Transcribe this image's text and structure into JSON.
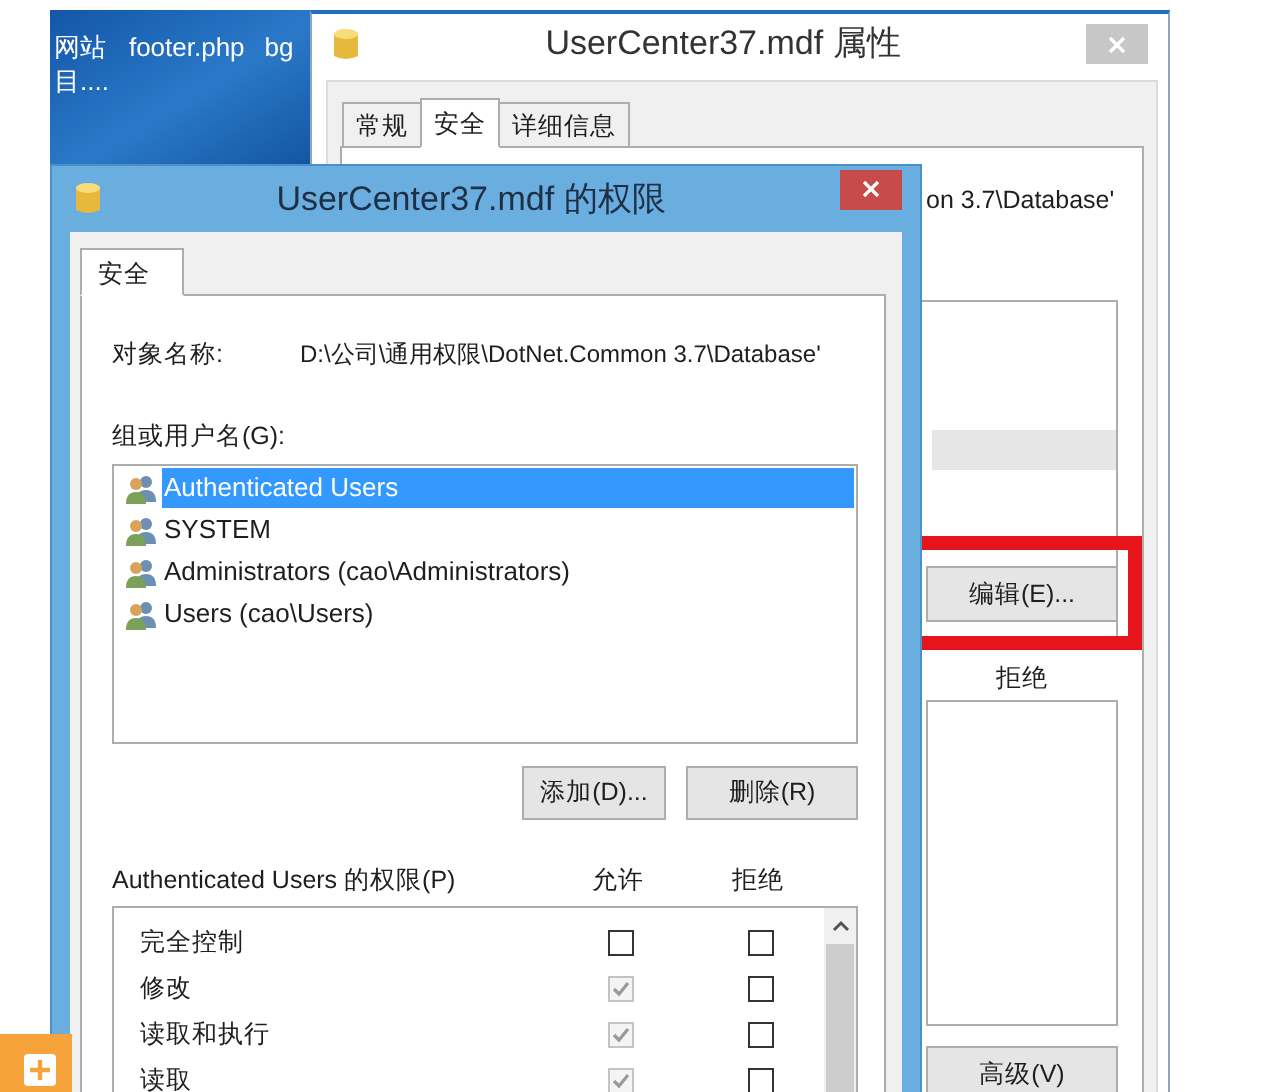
{
  "desktop": {
    "icons": [
      {
        "lines": [
          "网站",
          "目...."
        ]
      },
      {
        "lines": [
          "footer.php"
        ]
      },
      {
        "lines": [
          "bg"
        ]
      }
    ]
  },
  "properties_window": {
    "title": "UserCenter37.mdf 属性",
    "tabs": [
      {
        "label": "常规",
        "selected": false
      },
      {
        "label": "安全",
        "selected": true
      },
      {
        "label": "详细信息",
        "selected": false
      }
    ],
    "object_path_tail": "on 3.7\\Database'",
    "edit_button": "编辑(E)...",
    "deny_heading": "拒绝",
    "advanced_button": "高级(V)"
  },
  "permissions_window": {
    "title": "UserCenter37.mdf 的权限",
    "tabs": [
      {
        "label": "安全",
        "selected": true
      }
    ],
    "object_label": "对象名称:",
    "object_path": "D:\\公司\\通用权限\\DotNet.Common 3.7\\Database'",
    "group_label": "组或用户名(G):",
    "users": [
      {
        "name": "Authenticated Users",
        "selected": true
      },
      {
        "name": "SYSTEM",
        "selected": false
      },
      {
        "name": "Administrators (cao\\Administrators)",
        "selected": false
      },
      {
        "name": "Users (cao\\Users)",
        "selected": false
      }
    ],
    "buttons": [
      "添加(D)...",
      "删除(R)"
    ],
    "permissions_label": "Authenticated Users 的权限(P)",
    "columns": [
      "允许",
      "拒绝"
    ],
    "permissions": [
      {
        "name": "完全控制",
        "allow": {
          "checked": false,
          "disabled": false
        },
        "deny": {
          "checked": false,
          "disabled": false
        }
      },
      {
        "name": "修改",
        "allow": {
          "checked": true,
          "disabled": true
        },
        "deny": {
          "checked": false,
          "disabled": false
        }
      },
      {
        "name": "读取和执行",
        "allow": {
          "checked": true,
          "disabled": true
        },
        "deny": {
          "checked": false,
          "disabled": false
        }
      },
      {
        "name": "读取",
        "allow": {
          "checked": true,
          "disabled": true
        },
        "deny": {
          "checked": false,
          "disabled": false
        }
      }
    ]
  }
}
